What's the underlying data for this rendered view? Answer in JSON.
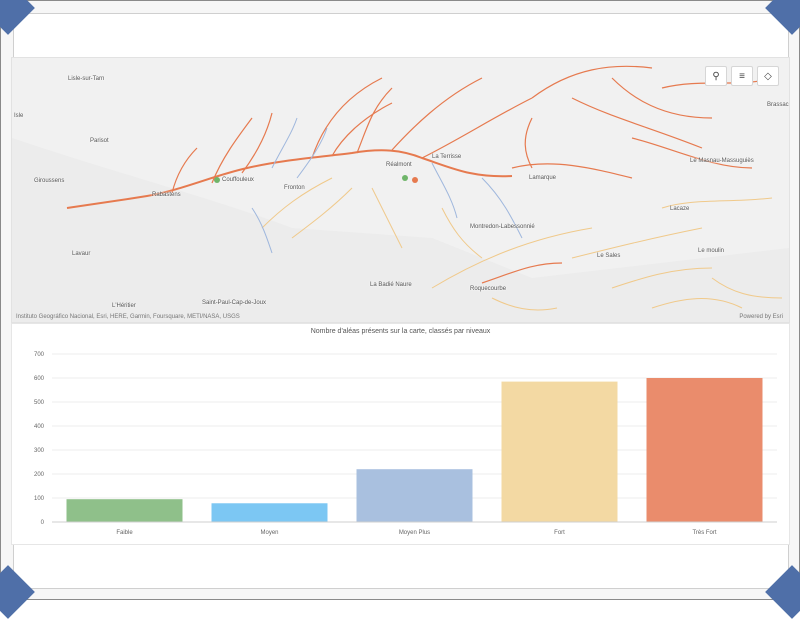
{
  "map": {
    "tools": {
      "search_icon": "search-icon",
      "legend_icon": "list-icon",
      "layers_icon": "layers-icon"
    },
    "places": [
      "Lisle-sur-Tarn",
      "Isle",
      "Parisot",
      "Giroussens",
      "Rabastens",
      "Couffouleux",
      "Fronton",
      "Réalmont",
      "La Terrisse",
      "Lamarque",
      "Montredon-Labessonnié",
      "Lavaur",
      "La Badié Naure",
      "Saint-Paul-Cap-de-Joux",
      "L'Héritier",
      "Roquecourbe",
      "Le Sales",
      "Le moulin",
      "Lacaze",
      "Le Masnau-Massuguiès",
      "Brassac"
    ],
    "attribution": "Instituto Geográfico Nacional, Esri, HERE, Garmin, Foursquare, METI/NASA, USGS",
    "powered_by": "Powered by Esri"
  },
  "chart_data": {
    "type": "bar",
    "title": "Nombre d'aléas présents sur la carte, classés par niveaux",
    "categories": [
      "Faible",
      "Moyen",
      "Moyen Plus",
      "Fort",
      "Très Fort"
    ],
    "values": [
      95,
      78,
      220,
      585,
      600
    ],
    "colors": [
      "#8fc08a",
      "#7cc7f3",
      "#a9c0df",
      "#f3d9a3",
      "#ea8c6c"
    ],
    "ylim": [
      0,
      700
    ],
    "yticks": [
      0,
      100,
      200,
      300,
      400,
      500,
      600,
      700
    ],
    "grid": true
  }
}
